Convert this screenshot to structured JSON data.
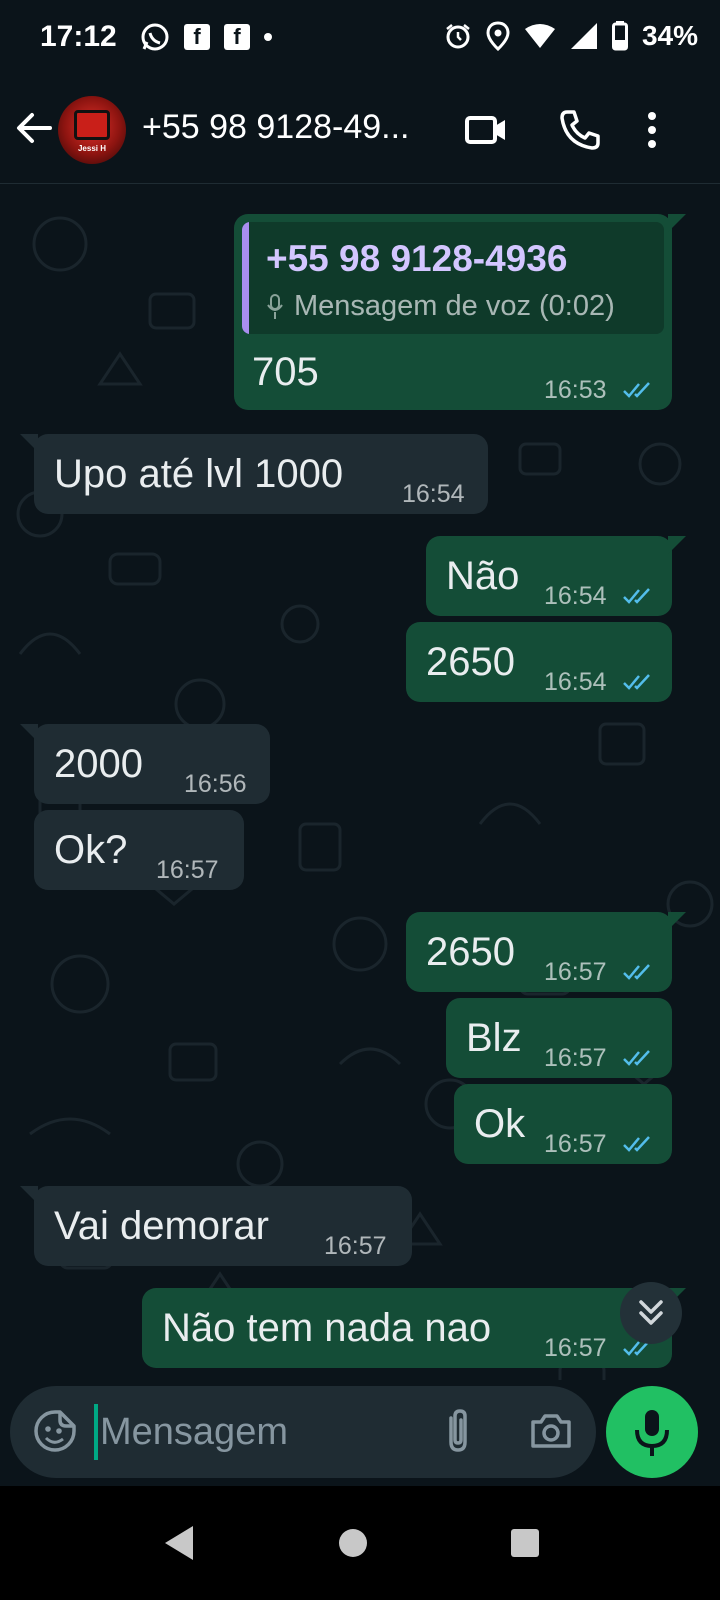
{
  "status_bar": {
    "time": "17:12",
    "battery": "34%",
    "icons": [
      "whatsapp-icon",
      "facebook-icon",
      "facebook-icon",
      "dot-icon",
      "alarm-icon",
      "location-icon",
      "wifi-icon",
      "signal-icon",
      "battery-icon"
    ]
  },
  "header": {
    "contact_name": "+55 98 9128-49...",
    "avatar_tag": "Jessi H",
    "icons": [
      "back-arrow-icon",
      "video-call-icon",
      "phone-icon",
      "more-vert-icon"
    ]
  },
  "messages": [
    {
      "dir": "out",
      "quote_name": "+55 98 9128-4936",
      "quote_text": "Mensagem de voz (0:02)",
      "text": "705",
      "time": "16:53",
      "read": true
    },
    {
      "dir": "in",
      "text": "Upo até lvl 1000",
      "time": "16:54"
    },
    {
      "dir": "out",
      "text": "Não",
      "time": "16:54",
      "read": true
    },
    {
      "dir": "out",
      "text": "2650",
      "time": "16:54",
      "read": true
    },
    {
      "dir": "in",
      "text": "2000",
      "time": "16:56"
    },
    {
      "dir": "in",
      "text": "Ok?",
      "time": "16:57"
    },
    {
      "dir": "out",
      "text": "2650",
      "time": "16:57",
      "read": true
    },
    {
      "dir": "out",
      "text": "Blz",
      "time": "16:57",
      "read": true
    },
    {
      "dir": "out",
      "text": "Ok",
      "time": "16:57",
      "read": true
    },
    {
      "dir": "in",
      "text": "Vai demorar",
      "time": "16:57"
    },
    {
      "dir": "out",
      "text": "Não tem nada nao",
      "time": "16:57",
      "read": true
    }
  ],
  "input": {
    "placeholder": "Mensagem",
    "icons": [
      "emoji-sticker-icon",
      "attach-icon",
      "camera-icon",
      "mic-icon"
    ]
  },
  "colors": {
    "background": "#0b141a",
    "outgoing_bubble": "#144d37",
    "incoming_bubble": "#1f2c33",
    "read_ticks": "#53bdeb",
    "accent": "#21c063"
  }
}
